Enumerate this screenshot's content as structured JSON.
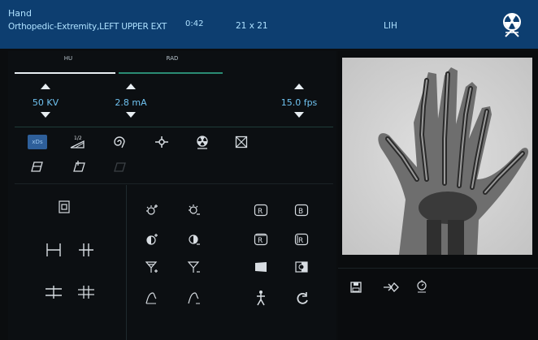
{
  "header": {
    "body_part": "Hand",
    "protocol": "Orthopedic-Extremity,LEFT UPPER EXT",
    "time": "0:42",
    "grid_size": "21 x 21",
    "orientation": "LIH",
    "radiation_icon": "radiation-hazard-icon"
  },
  "tabs": [
    {
      "label": "HU",
      "active": true
    },
    {
      "label": "RAD",
      "active": false
    }
  ],
  "params": {
    "kv": "50 KV",
    "ma": "2.8 mA",
    "fps": "15.0 fps"
  },
  "toolbar": {
    "active_button_label": "xDs",
    "fraction_label": "1/2"
  },
  "colors": {
    "header_bg": "#0d3e70",
    "accent": "#6fc2f0",
    "active_button": "#2e5f9a"
  }
}
